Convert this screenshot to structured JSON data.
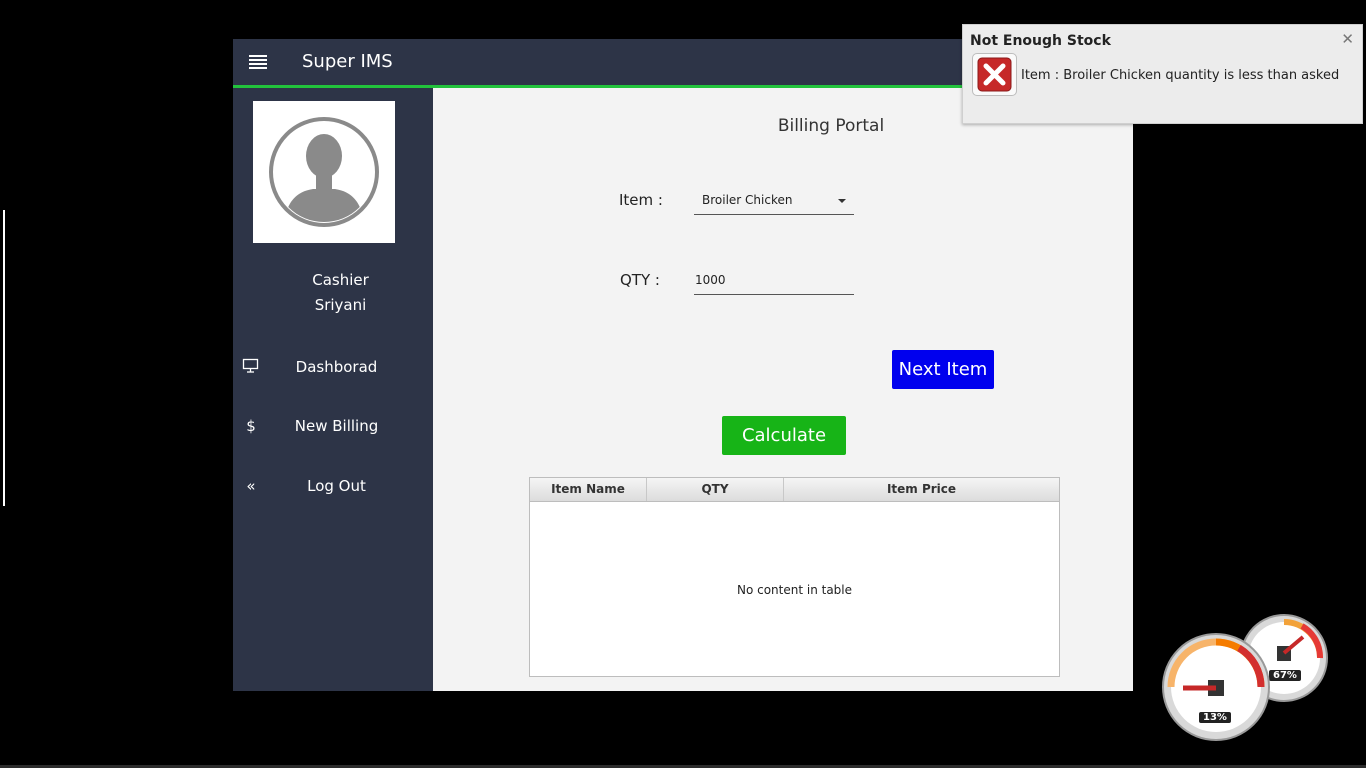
{
  "app": {
    "title": "Super IMS",
    "user": {
      "role": "Cashier",
      "name": "Sriyani"
    },
    "nav": [
      {
        "label": "Dashborad",
        "icon": "monitor-icon"
      },
      {
        "label": "New Billing",
        "icon": "dollar-icon"
      },
      {
        "label": "Log Out",
        "icon": "double-chevron-left-icon"
      }
    ]
  },
  "billing": {
    "title": "Billing Portal",
    "item_label": "Item :",
    "item_value": "Broiler Chicken",
    "qty_label": "QTY :",
    "qty_value": "1000",
    "next_button": "Next Item",
    "calculate_button": "Calculate",
    "table": {
      "columns": [
        "Item Name",
        "QTY",
        "Item Price"
      ],
      "empty_text": "No content in table"
    }
  },
  "toast": {
    "title": "Not Enough Stock",
    "message": "Item : Broiler Chicken quantity is less than asked",
    "icon": "error-x-icon"
  },
  "gauges": {
    "cpu_percent": "13%",
    "memory_percent": "67%"
  },
  "colors": {
    "sidebar": "#2d3447",
    "accent_line": "#22c33c",
    "next_button": "#0000ee",
    "calculate_button": "#17b417"
  }
}
